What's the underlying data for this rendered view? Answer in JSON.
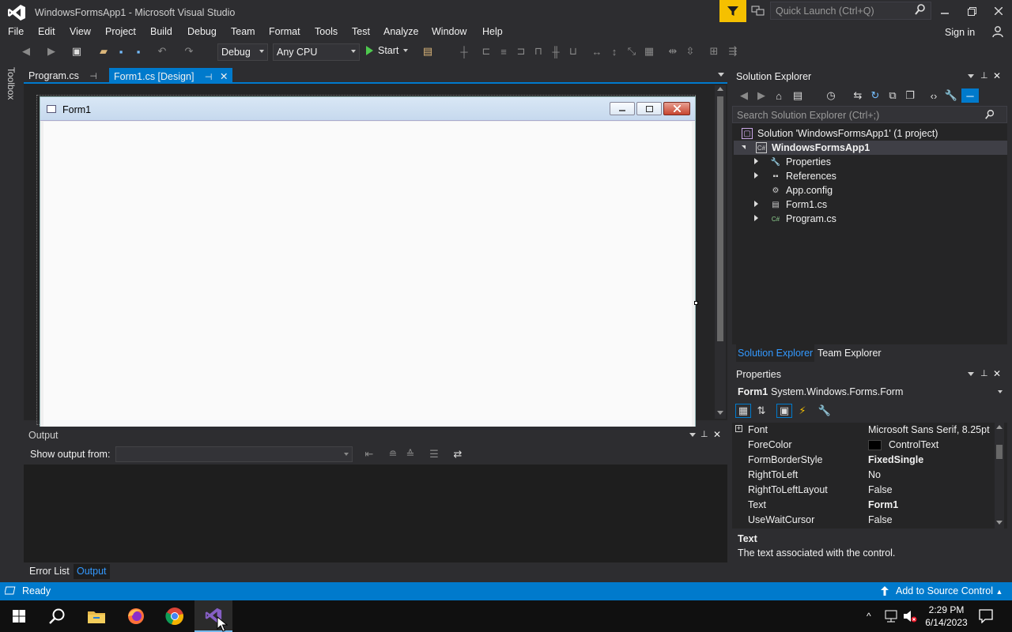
{
  "window": {
    "title": "WindowsFormsApp1 - Microsoft Visual Studio",
    "quick_launch_placeholder": "Quick Launch (Ctrl+Q)"
  },
  "menu": {
    "items": [
      "File",
      "Edit",
      "View",
      "Project",
      "Build",
      "Debug",
      "Team",
      "Format",
      "Tools",
      "Test",
      "Analyze",
      "Window",
      "Help"
    ],
    "sign_in": "Sign in"
  },
  "toolbar": {
    "config": "Debug",
    "platform": "Any CPU",
    "start": "Start"
  },
  "toolbox": {
    "label": "Toolbox"
  },
  "doc_tabs": [
    {
      "label": "Program.cs",
      "active": false
    },
    {
      "label": "Form1.cs [Design]",
      "active": true
    }
  ],
  "designer": {
    "form_title": "Form1"
  },
  "output": {
    "title": "Output",
    "show_output_from": "Show output from:",
    "source_value": "",
    "tabs": [
      "Error List",
      "Output"
    ]
  },
  "solution_explorer": {
    "title": "Solution Explorer",
    "search_placeholder": "Search Solution Explorer (Ctrl+;)",
    "solution": "Solution 'WindowsFormsApp1' (1 project)",
    "project": "WindowsFormsApp1",
    "items": [
      "Properties",
      "References",
      "App.config",
      "Form1.cs",
      "Program.cs"
    ],
    "tabs": [
      "Solution Explorer",
      "Team Explorer"
    ]
  },
  "properties": {
    "title": "Properties",
    "object_name": "Form1",
    "object_type": "System.Windows.Forms.Form",
    "rows": [
      {
        "name": "Font",
        "value": "Microsoft Sans Serif, 8.25pt",
        "bold": false,
        "expandable": true
      },
      {
        "name": "ForeColor",
        "value": "ControlText",
        "bold": false,
        "swatch": "#000000"
      },
      {
        "name": "FormBorderStyle",
        "value": "FixedSingle",
        "bold": true
      },
      {
        "name": "RightToLeft",
        "value": "No",
        "bold": false
      },
      {
        "name": "RightToLeftLayout",
        "value": "False",
        "bold": false
      },
      {
        "name": "Text",
        "value": "Form1",
        "bold": true
      },
      {
        "name": "UseWaitCursor",
        "value": "False",
        "bold": false
      }
    ],
    "desc_title": "Text",
    "desc_text": "The text associated with the control."
  },
  "status": {
    "text": "Ready",
    "source_control": "Add to Source Control"
  },
  "taskbar": {
    "time": "2:29 PM",
    "date": "6/14/2023"
  },
  "colors": {
    "accent": "#007acc",
    "background": "#2d2d30",
    "feedback_filter": "#f5c000"
  }
}
